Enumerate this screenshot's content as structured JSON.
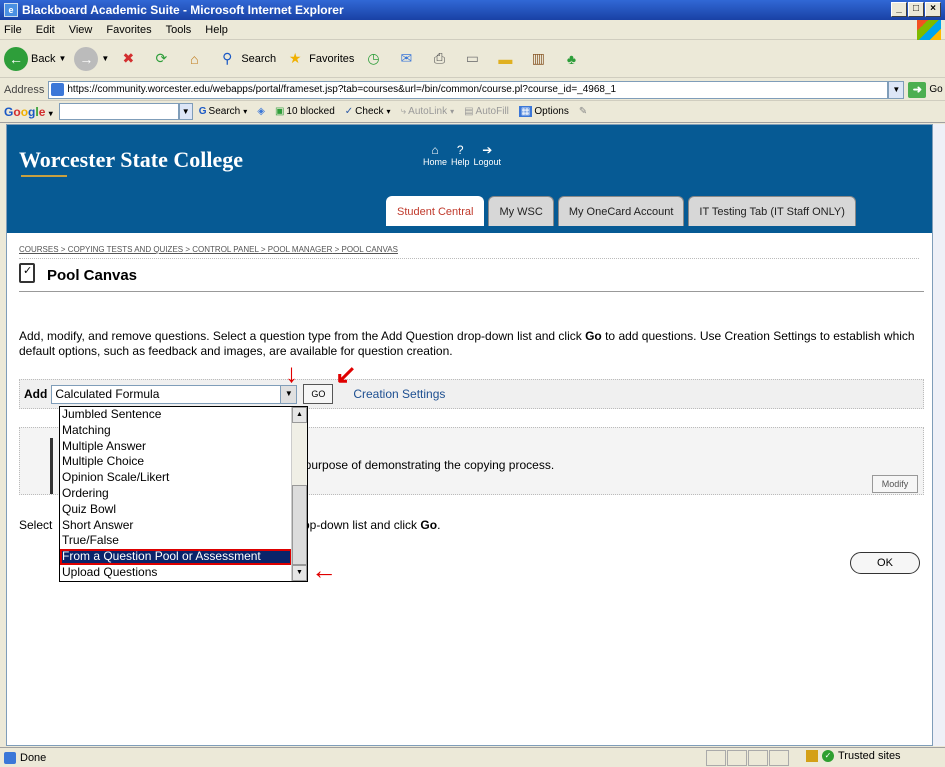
{
  "window": {
    "title": "Blackboard Academic Suite - Microsoft Internet Explorer"
  },
  "menu": [
    "File",
    "Edit",
    "View",
    "Favorites",
    "Tools",
    "Help"
  ],
  "toolbar": {
    "back": "Back",
    "search": "Search",
    "favorites": "Favorites"
  },
  "address": {
    "label": "Address",
    "url": "https://community.worcester.edu/webapps/portal/frameset.jsp?tab=courses&url=/bin/common/course.pl?course_id=_4968_1",
    "go": "Go"
  },
  "googlebar": {
    "search": "Search",
    "blocked": "10 blocked",
    "check": "Check",
    "autolink": "AutoLink",
    "autofill": "AutoFill",
    "options": "Options"
  },
  "site": {
    "title": "Worcester State College",
    "nav": [
      {
        "label": "Home",
        "icon": "home-icon"
      },
      {
        "label": "Help",
        "icon": "help-icon"
      },
      {
        "label": "Logout",
        "icon": "logout-icon"
      }
    ],
    "tabs": [
      "Student Central",
      "My WSC",
      "My OneCard Account",
      "IT Testing Tab (IT Staff ONLY)"
    ]
  },
  "breadcrumb": [
    "COURSES",
    "COPYING TESTS AND QUIZES",
    "CONTROL PANEL",
    "POOL MANAGER",
    "POOL CANVAS"
  ],
  "page": {
    "title": "Pool Canvas",
    "intro_1": "Add, modify, and remove questions. Select a question type from the Add Question drop-down list and click ",
    "intro_go": "Go",
    "intro_2": " to add questions. Use Creation Settings to establish which default options, such as feedback and images, are available for question creation.",
    "add_label": "Add",
    "add_selected": "Calculated Formula",
    "go_button": "GO",
    "creation_settings": "Creation Settings",
    "panel_text": "he purpose of demonstrating the copying process.",
    "modify_button": "Modify",
    "select_text_left": "Select",
    "select_text_right": "op-down list and click ",
    "select_text_go": "Go",
    "select_text_end": ".",
    "ok_button": "OK"
  },
  "dropdown_items": [
    "Jumbled Sentence",
    "Matching",
    "Multiple Answer",
    "Multiple Choice",
    "Opinion Scale/Likert",
    "Ordering",
    "Quiz Bowl",
    "Short Answer",
    "True/False",
    "From a Question Pool or Assessment",
    "Upload Questions"
  ],
  "dropdown_selected_index": 9,
  "status": {
    "text": "Done",
    "zone": "Trusted sites"
  }
}
